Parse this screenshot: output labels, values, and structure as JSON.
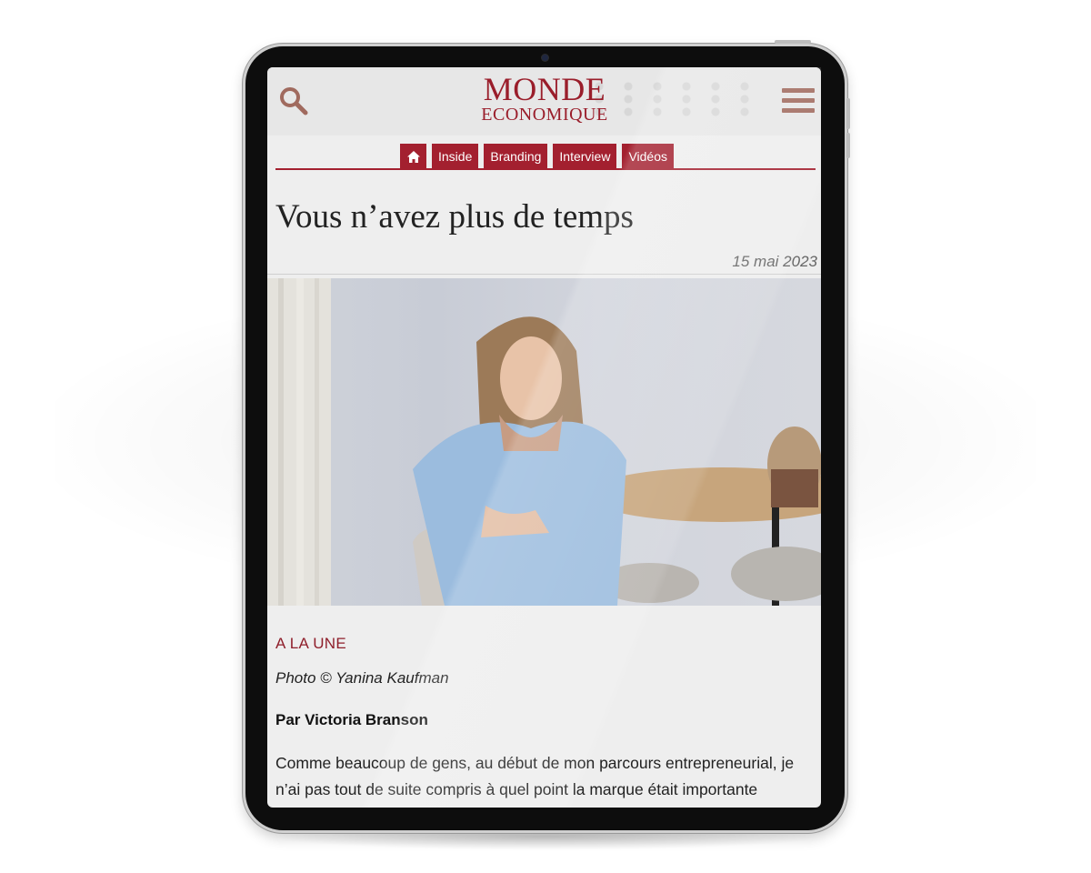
{
  "header": {
    "logo_top": "MONDE",
    "logo_bottom": "ECONOMIQUE",
    "search_icon": "search-icon",
    "menu_icon": "hamburger-icon"
  },
  "nav": {
    "home_icon": "home-icon",
    "items": [
      "Inside",
      "Branding",
      "Interview",
      "Vidéos"
    ]
  },
  "article": {
    "title": "Vous n’avez plus de temps",
    "date": "15 mai 2023",
    "category": "A LA UNE",
    "photo_credit": "Photo © Yanina Kaufman",
    "byline": "Par Victoria Branson",
    "body": "Comme beaucoup de gens, au début de mon parcours entrepreneurial, je n’ai pas tout de suite compris à quel point la marque était importante"
  },
  "colors": {
    "brand": "#9a1e2b",
    "nav_bg": "#a3202f",
    "icon": "#a06a5e",
    "page_bg": "#eeeeee"
  }
}
